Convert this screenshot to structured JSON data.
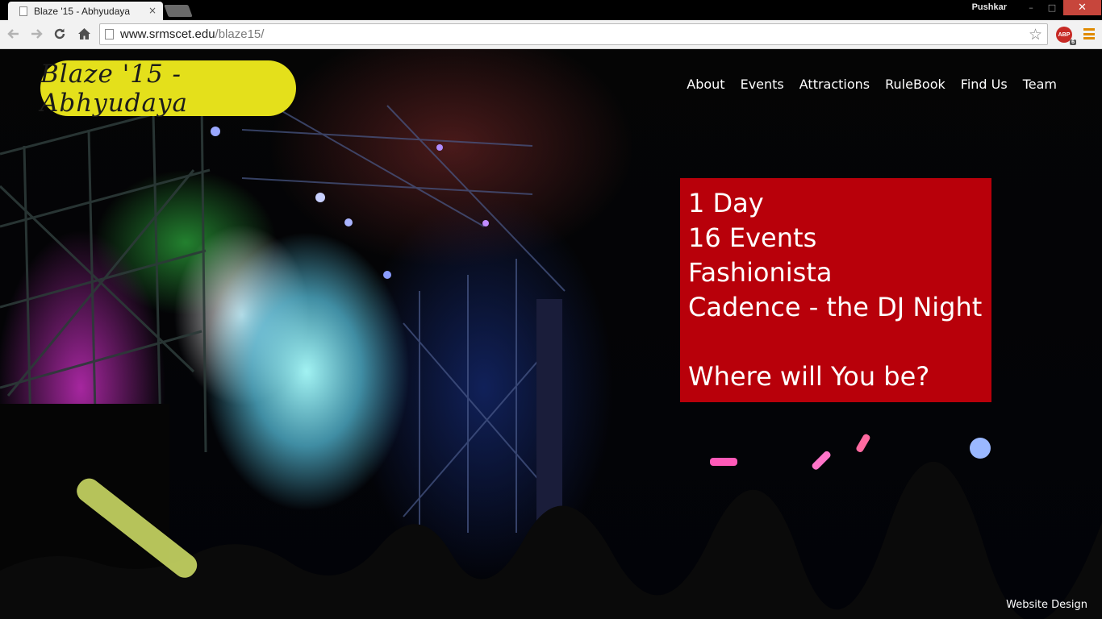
{
  "browser": {
    "tab_title": "Blaze '15 - Abhyudaya",
    "tab_close": "×",
    "user_name": "Pushkar",
    "url_host": "www.srmscet.edu",
    "url_path": "/blaze15/",
    "abp_label": "ABP",
    "abp_count": "6",
    "window_controls": {
      "minimize": "–",
      "maximize": "□",
      "close": "✕"
    }
  },
  "site": {
    "logo": "Blaze '15 - Abhyudaya",
    "nav": [
      "About",
      "Events",
      "Attractions",
      "RuleBook",
      "Find Us",
      "Team"
    ],
    "promo": {
      "lines": [
        "1 Day",
        "16 Events",
        "Fashionista",
        "Cadence - the DJ Night"
      ],
      "tagline": "Where will You be?",
      "background": "#b8000a"
    },
    "logo_color": "#e4e01b",
    "footer_link": "Website Design"
  }
}
